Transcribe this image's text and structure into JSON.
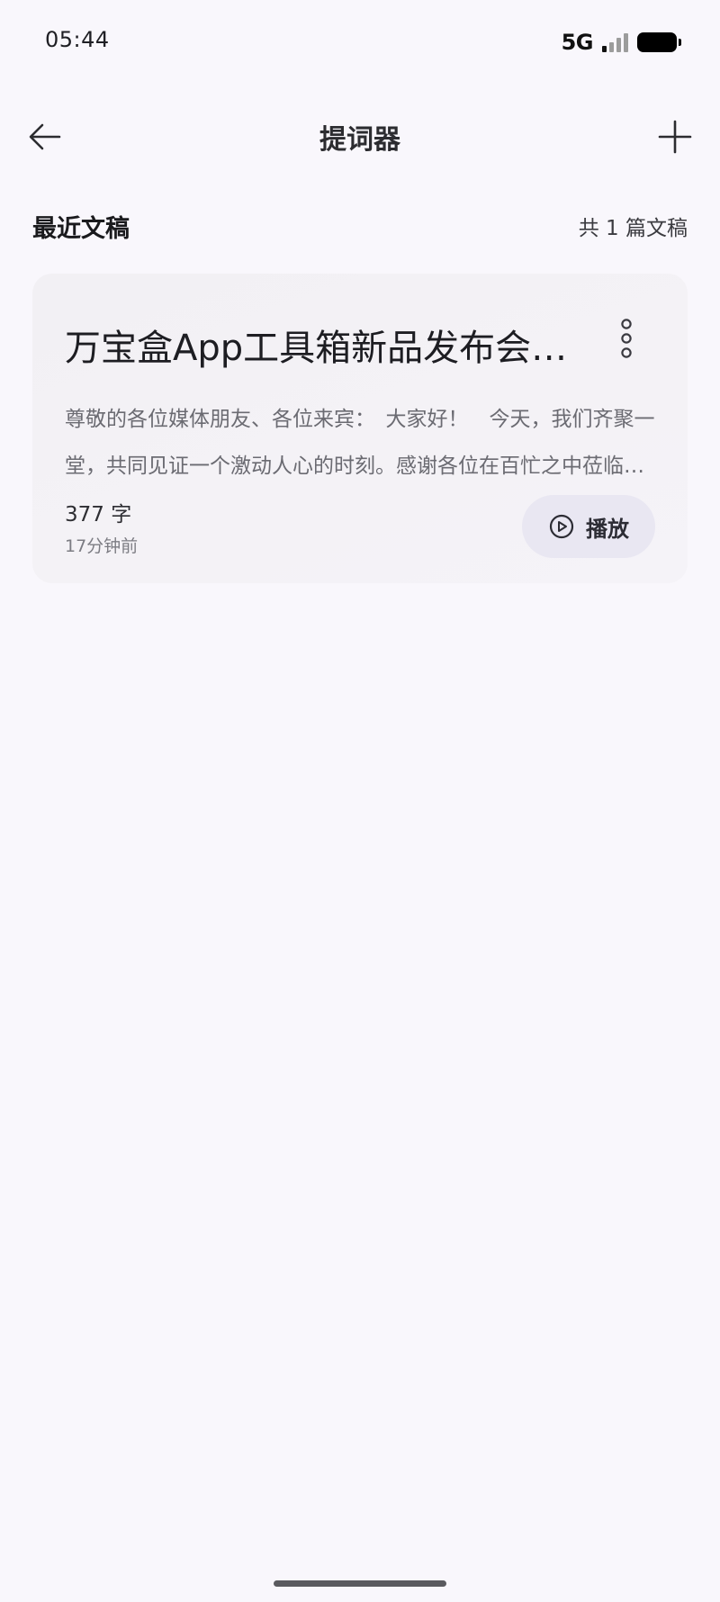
{
  "status_bar": {
    "time": "05:44",
    "network": "5G",
    "signal_icon": "signal-icon",
    "battery_icon": "battery-icon"
  },
  "header": {
    "title": "提词器",
    "back_icon": "arrow-left-icon",
    "add_icon": "plus-icon"
  },
  "section": {
    "title": "最近文稿",
    "count_text": "共 1 篇文稿"
  },
  "documents": [
    {
      "title": "万宝盒App工具箱新品发布会演讲稿",
      "preview": "尊敬的各位媒体朋友、各位来宾：　大家好！　今天，我们齐聚一堂，共同见证一个激动人心的时刻。感谢各位在百忙之中莅临现场。",
      "word_count": "377 字",
      "time": "17分钟前",
      "play_label": "播放",
      "more_icon": "more-vertical-icon",
      "play_icon": "play-circle-icon"
    }
  ],
  "colors": {
    "background": "#f9f7fc",
    "card": "#f3f1f5",
    "play_button": "#e9e7f2",
    "primary_text": "#1d1d22",
    "secondary_text": "#6b6b72"
  }
}
